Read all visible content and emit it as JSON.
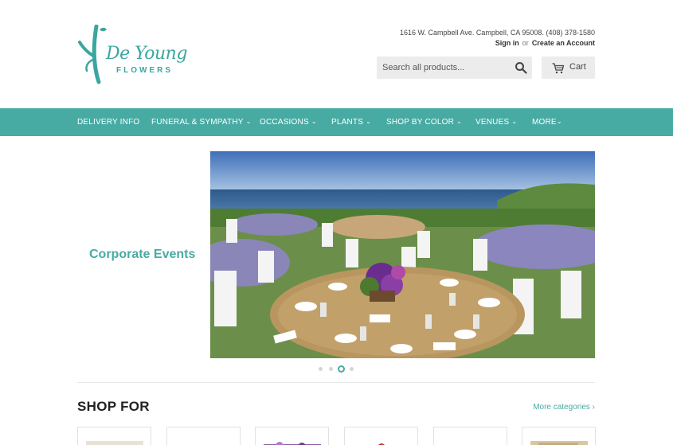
{
  "brand": {
    "logo_text": "De Young",
    "logo_sub": "FLOWERS",
    "logo_color": "#3aa6a0"
  },
  "header": {
    "address": "1616 W. Campbell Ave. Campbell, CA 95008. (408) 378-1580",
    "sign_in": "Sign in",
    "or": "or",
    "create_account": "Create an Account",
    "search_placeholder": "Search all products...",
    "search_icon": "search-icon",
    "cart_label": "Cart",
    "cart_icon": "cart-icon"
  },
  "nav": {
    "accent": "#48aba3",
    "items": [
      {
        "label": "DELIVERY INFO",
        "dropdown": false
      },
      {
        "label": "FUNERAL & SYMPATHY",
        "dropdown": true
      },
      {
        "label": "OCCASIONS",
        "dropdown": true
      },
      {
        "label": "PLANTS",
        "dropdown": true
      },
      {
        "label": "SHOP BY COLOR",
        "dropdown": true
      },
      {
        "label": "VENUES",
        "dropdown": true
      },
      {
        "label": "MORE",
        "dropdown": true
      }
    ]
  },
  "hero": {
    "caption": "Corporate Events",
    "slide_count": 4,
    "active_slide": 3
  },
  "shop": {
    "title": "SHOP FOR",
    "more_link": "More categories ›"
  }
}
